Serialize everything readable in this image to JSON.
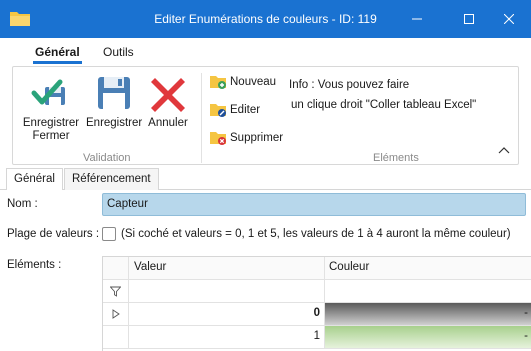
{
  "window": {
    "title": "Editer Enumérations de couleurs - ID: 119",
    "app_icon": "folder-icon",
    "controls": [
      "minimize-icon",
      "maximize-icon",
      "close-icon"
    ]
  },
  "ribbon_tabs": [
    {
      "label": "Général",
      "active": true
    },
    {
      "label": "Outils",
      "active": false
    }
  ],
  "ribbon": {
    "validation": {
      "group_label": "Validation",
      "save_close": {
        "label_line1": "Enregistrer",
        "label_line2": "Fermer",
        "icon": "save-close-icon"
      },
      "save": {
        "label": "Enregistrer",
        "icon": "floppy-disk-icon"
      },
      "cancel": {
        "label": "Annuler",
        "icon": "red-x-icon"
      }
    },
    "elements": {
      "group_label": "Eléments",
      "nouveau": "Nouveau",
      "editer": "Editer",
      "supprimer": "Supprimer"
    },
    "info_line1": "Info : Vous pouvez faire",
    "info_line2": "un clique droit \"Coller tableau Excel\""
  },
  "form_tabs": [
    {
      "label": "Général",
      "active": true
    },
    {
      "label": "Référencement",
      "active": false
    }
  ],
  "form": {
    "nom_label": "Nom :",
    "nom_value": "Capteur",
    "plage_label": "Plage de valeurs :",
    "plage_checked": false,
    "plage_hint": "(Si coché et valeurs = 0, 1 et 5, les valeurs de 1 à 4 auront la même couleur)",
    "elements_label": "Eléments :"
  },
  "grid": {
    "columns": [
      "Valeur",
      "Couleur"
    ],
    "rows": [
      {
        "valeur": "0",
        "couleur": "-",
        "color": "#5a5a5a",
        "color_end": "#d0d0d0"
      },
      {
        "valeur": "1",
        "couleur": "-",
        "color": "#a8d08d",
        "color_end": "#e6f2dc"
      }
    ]
  },
  "colors": {
    "titlebar": "#1a72d1",
    "accent": "#1a72d1",
    "nom_input_bg": "#b7d7eb"
  }
}
